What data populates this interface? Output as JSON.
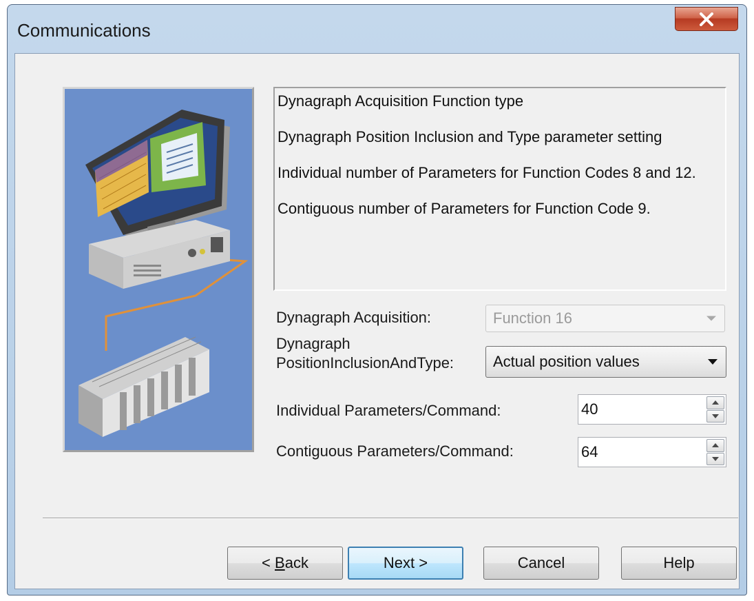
{
  "window": {
    "title": "Communications",
    "close_glyph": "X"
  },
  "description": {
    "lines": [
      "Dynagraph Acquisition Function type",
      "Dynagraph Position Inclusion and Type parameter setting",
      "Individual number of Parameters for Function Codes 8 and 12.",
      "Contiguous number of Parameters for Function Code 9."
    ]
  },
  "form": {
    "acquisition_label": "Dynagraph Acquisition:",
    "acquisition_value": "Function 16",
    "position_label_line1": "Dynagraph",
    "position_label_line2": "PositionInclusionAndType:",
    "position_value": "Actual position values",
    "individual_label": "Individual Parameters/Command:",
    "individual_value": "40",
    "contiguous_label": "Contiguous Parameters/Command:",
    "contiguous_value": "64"
  },
  "buttons": {
    "back_prefix": "< ",
    "back_mnemonic": "B",
    "back_rest": "ack",
    "next": "Next >",
    "cancel": "Cancel",
    "help": "Help"
  },
  "icons": [
    "close-icon",
    "computer-network-illustration",
    "dropdown-arrow-icon",
    "spin-up-icon",
    "spin-down-icon"
  ],
  "colors": {
    "illustration_bg": "#6b8fcb",
    "close_button": "#c9503a",
    "default_button_border": "#3c7fb1"
  }
}
